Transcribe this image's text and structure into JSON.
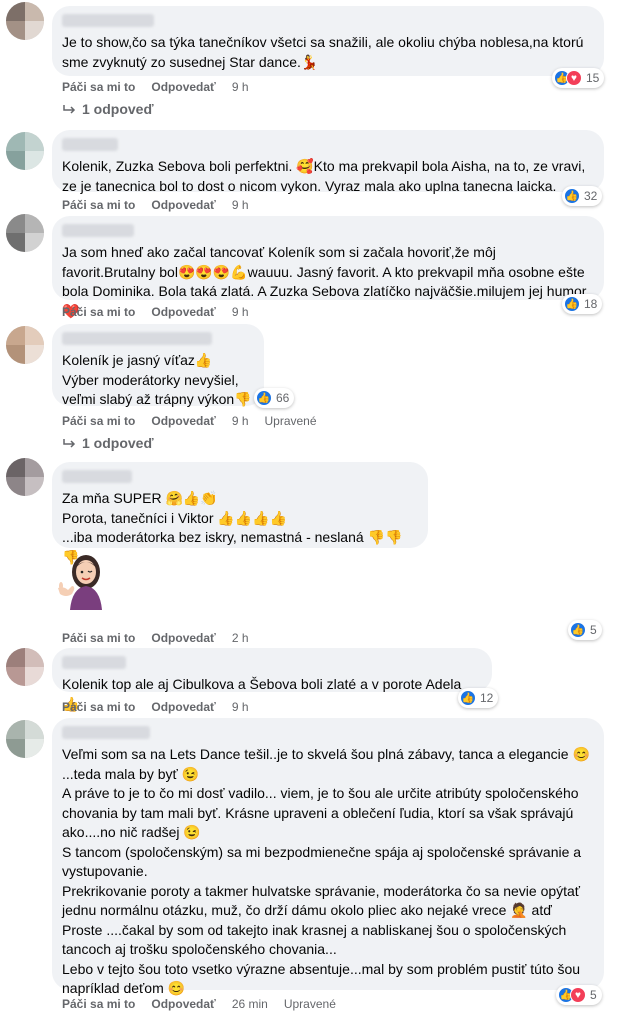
{
  "actions": {
    "like": "Páči sa mi to",
    "reply": "Odpovedať",
    "edited": "Upravené"
  },
  "colors": {
    "bubble": "#f0f2f5",
    "muted": "#65676b",
    "like": "#1b74e4",
    "love": "#f33e58"
  },
  "comments": [
    {
      "text": "Je to show,čo sa týka tanečníkov všetci sa snažili, ale okoliu chýba noblesa,na ktorú sme zvyknutý zo susednej Star dance.💃",
      "time": "9 h",
      "reactions_count": "15",
      "reaction_types": [
        "like-icon",
        "love-icon"
      ],
      "replies_label": "1 odpoveď"
    },
    {
      "text": "Kolenik, Zuzka Sebova boli perfektni. 🥰Kto ma prekvapil bola Aisha, na to, ze vravi, ze je tanecnica bol to dost o nicom vykon. Vyraz mala ako uplna tanecna laicka.",
      "time": "9 h",
      "reactions_count": "32",
      "reaction_types": [
        "like-icon"
      ]
    },
    {
      "text": "Ja som hneď ako začal tancovať Koleník som si začala hovoriť,že môj favorit.Brutalny bol😍😍😍💪wauuu. Jasný favorit. A kto prekvapil mňa osobne ešte bola Dominika. Bola taká zlatá. A Zuzka Sebova zlatíčko najväčšie.milujem jej humor.❤️",
      "time": "9 h",
      "reactions_count": "18",
      "reaction_types": [
        "like-icon"
      ]
    },
    {
      "text": "Koleník je jasný víťaz👍\nVýber moderátorky nevyšiel,\nveľmi slabý až trápny výkon👎",
      "time": "9 h",
      "edited": true,
      "reactions_count": "66",
      "reaction_types": [
        "like-icon"
      ],
      "replies_label": "1 odpoveď"
    },
    {
      "text": "Za mňa SUPER 🤗👍👏\nPorota, tanečníci i Viktor 👍👍👍👍\n...iba moderátorka bez iskry, nemastná - neslaná 👎👎👎",
      "time": "2 h",
      "reactions_count": "5",
      "reaction_types": [
        "like-icon"
      ],
      "sticker": "woman-thumbs-up-sticker"
    },
    {
      "text": "Kolenik top ale aj Cibulkova a Šebova boli zlaté a v porote Adela 👍",
      "time": "9 h",
      "reactions_count": "12",
      "reaction_types": [
        "like-icon"
      ]
    },
    {
      "text": "Veľmi som sa na Lets Dance tešil..je to skvelá šou plná zábavy, tanca a elegancie 😊\n...teda mala by byť 😉\nA práve to je to čo mi dosť vadilo... viem, je to šou ale určite atribúty spoločenského chovania by tam mali byť. Krásne upraveni a oblečení ľudia, ktorí sa však správajú ako....no nič radšej 😉\nS tancom (spoločenským) sa mi bezpodmienečne spája aj spoločenské správanie a vystupovanie.\nPrekrikovanie poroty a takmer hulvatske správanie, moderátorka čo sa nevie opýtať jednu normálnu otázku, muž, čo drží dámu okolo pliec ako nejaké vrece 🤦 atď\nProste ....čakal by som od takejto inak krasnej a nabliskanej šou o spoločenských tancoch aj trošku spoločenského chovania...\nLebo v tejto šou toto vsetko výrazne absentuje...mal by som problém pustiť túto šou napríklad deťom 😊",
      "time": "26 min",
      "edited": true,
      "reactions_count": "5",
      "reaction_types": [
        "like-icon",
        "love-icon"
      ]
    }
  ]
}
